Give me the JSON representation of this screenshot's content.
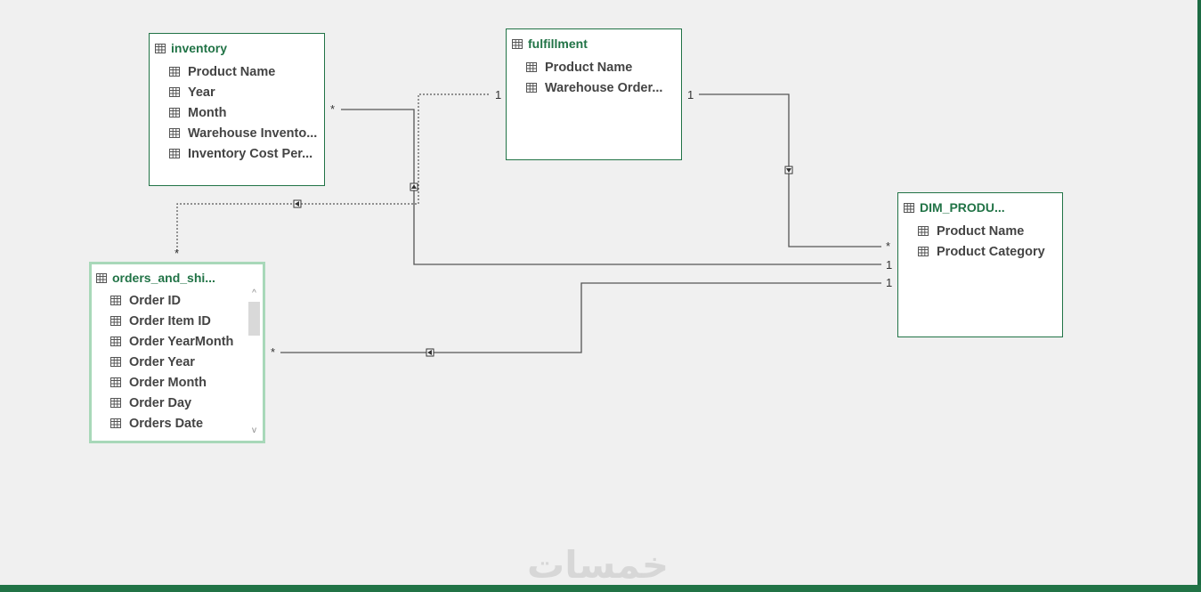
{
  "tables": {
    "inventory": {
      "title": "inventory",
      "fields": [
        "Product Name",
        "Year",
        "Month",
        "Warehouse Invento...",
        "Inventory Cost Per..."
      ]
    },
    "fulfillment": {
      "title": "fulfillment",
      "fields": [
        "Product Name",
        "Warehouse Order..."
      ]
    },
    "dim_product": {
      "title": "DIM_PRODU...",
      "fields": [
        "Product Name",
        "Product Category"
      ]
    },
    "orders": {
      "title": "orders_and_shi...",
      "fields": [
        "Order ID",
        "Order Item ID",
        "Order YearMonth",
        "Order Year",
        "Order Month",
        "Order Day",
        "Orders Date"
      ]
    }
  },
  "cardinality": {
    "inv_many": "*",
    "ful_one_left": "1",
    "ful_one_right": "1",
    "orders_many_top": "*",
    "dim_many": "*",
    "dim_one_a": "1",
    "dim_one_b": "1",
    "orders_many_right": "*"
  },
  "scroll": {
    "up": "^",
    "down": "v"
  },
  "watermark": "خمسات",
  "colors": {
    "accent": "#217346",
    "selected_border": "#a8d8b9",
    "line": "#555555",
    "background": "#f0f0f0"
  },
  "icons": {
    "table": "table-icon"
  }
}
